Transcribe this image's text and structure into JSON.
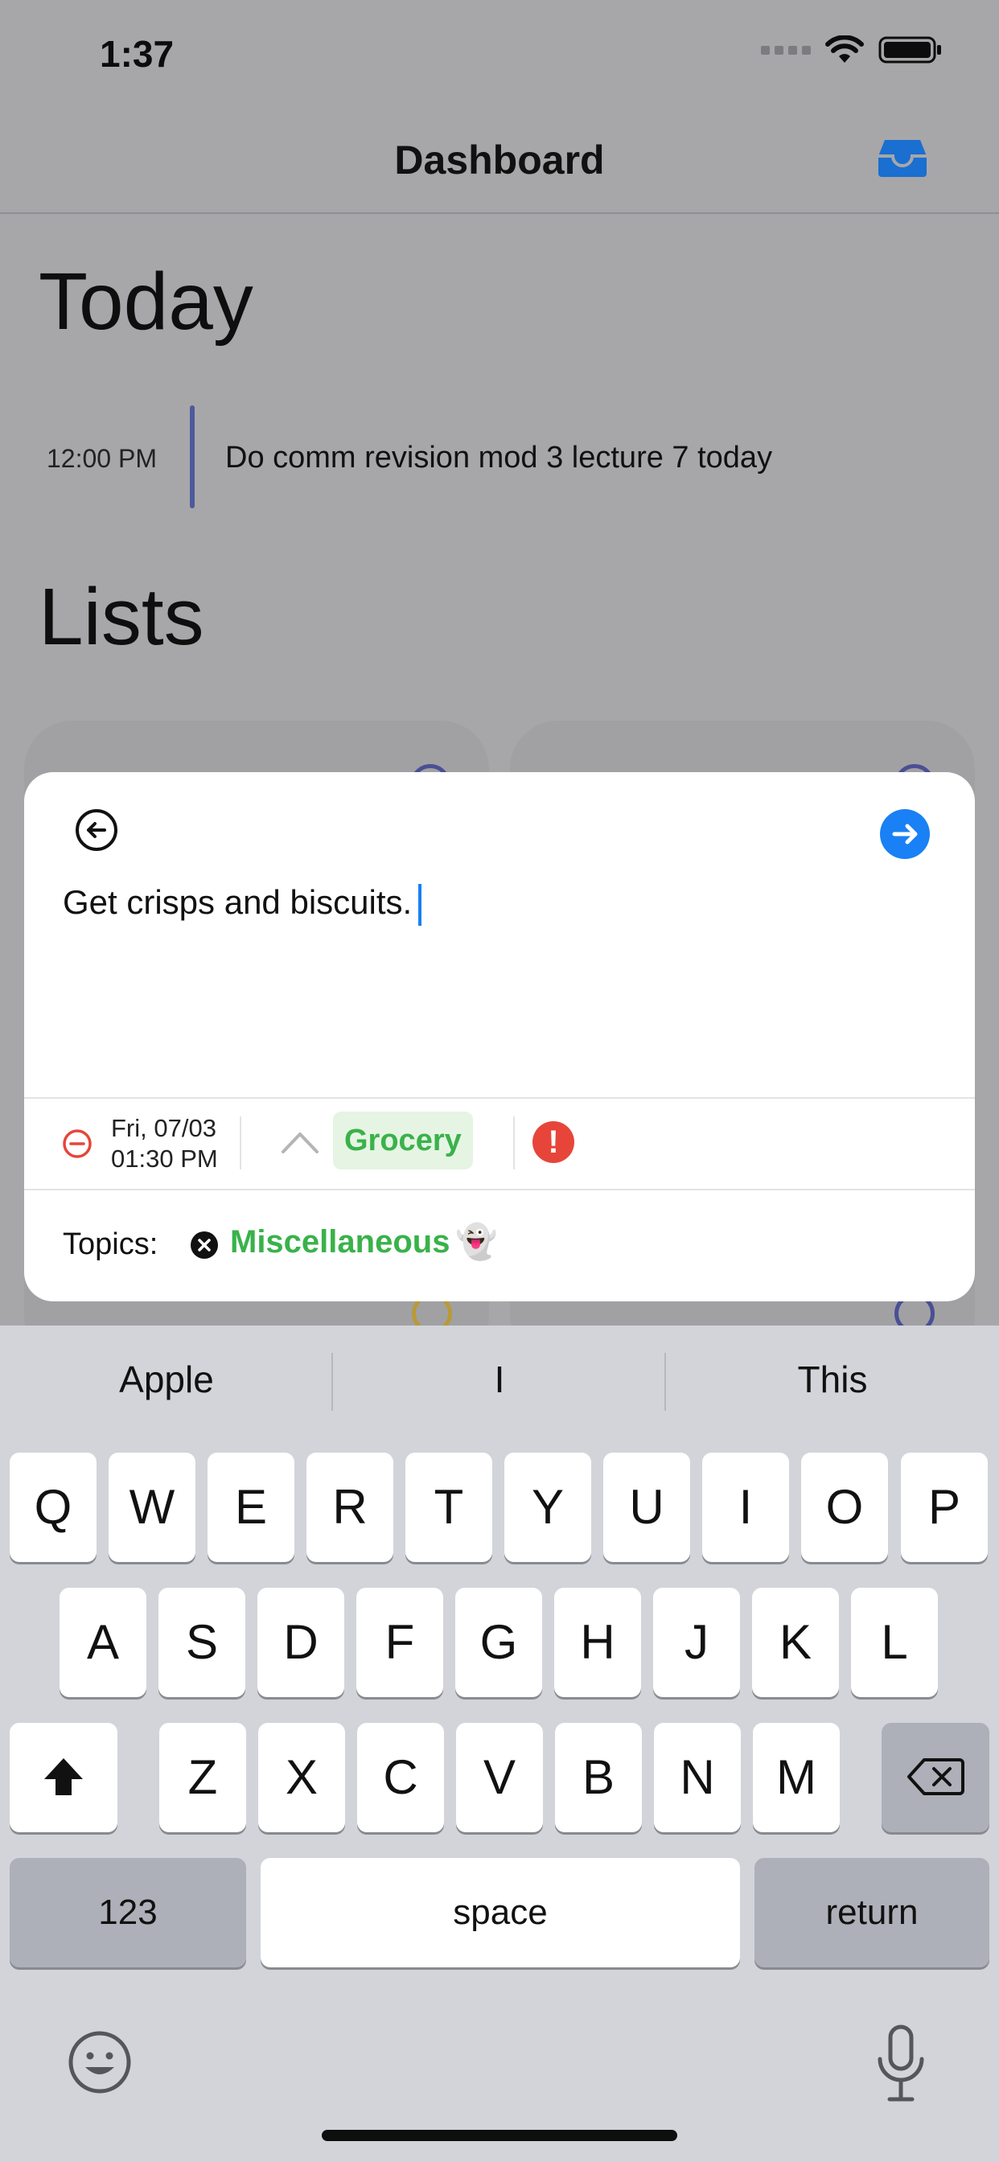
{
  "status": {
    "time": "1:37"
  },
  "nav": {
    "title": "Dashboard"
  },
  "sections": {
    "today": "Today",
    "lists": "Lists"
  },
  "today_event": {
    "time": "12:00 PM",
    "title": "Do comm revision mod 3 lecture 7 today"
  },
  "editor": {
    "text": "Get crisps and biscuits.",
    "date_line1": "Fri, 07/03",
    "date_line2": "01:30 PM",
    "list_name": "Grocery",
    "priority_mark": "!",
    "topics_label": "Topics:",
    "topic": "Miscellaneous",
    "topic_emoji": "👻"
  },
  "keyboard": {
    "suggestions": [
      "Apple",
      "I",
      "This"
    ],
    "row1": [
      "Q",
      "W",
      "E",
      "R",
      "T",
      "Y",
      "U",
      "I",
      "O",
      "P"
    ],
    "row2": [
      "A",
      "S",
      "D",
      "F",
      "G",
      "H",
      "J",
      "K",
      "L"
    ],
    "row3": [
      "Z",
      "X",
      "C",
      "V",
      "B",
      "N",
      "M"
    ],
    "numbers": "123",
    "space": "space",
    "return": "return"
  },
  "colors": {
    "accent": "#1a80f5",
    "green": "#39b24a",
    "priority_red": "#e7453a",
    "event_bar": "#4e5a9c",
    "dimmed_bg": "#a7a7aa",
    "keyboard_bg": "#d2d4da"
  },
  "icons": [
    "signal-icon",
    "wifi-icon",
    "battery-icon",
    "inbox-icon",
    "back-arrow-icon",
    "forward-arrow-icon",
    "remove-date-icon",
    "chevron-up-icon",
    "priority-icon",
    "remove-topic-icon",
    "shift-icon",
    "backspace-icon",
    "emoji-icon",
    "microphone-icon"
  ]
}
